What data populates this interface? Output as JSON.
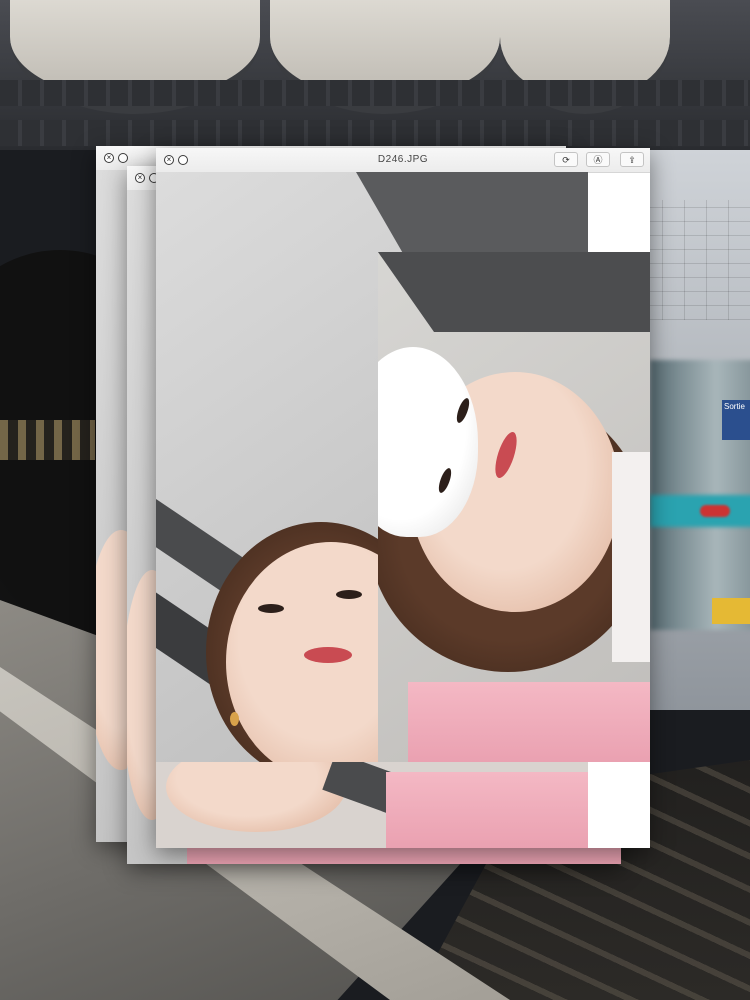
{
  "front_window": {
    "title": "D246.JPG",
    "close_glyph": "×",
    "toolbar": [
      {
        "name": "rotate-button",
        "icon": "rotate-icon",
        "glyph": "⟳"
      },
      {
        "name": "markup-button",
        "icon": "pen-icon",
        "glyph": "Ⓐ"
      },
      {
        "name": "share-button",
        "icon": "share-icon",
        "glyph": "⇪"
      }
    ]
  },
  "back_windows": [
    {
      "close_glyph": "×"
    },
    {
      "close_glyph": "×"
    }
  ],
  "sign_text": "Sortie"
}
